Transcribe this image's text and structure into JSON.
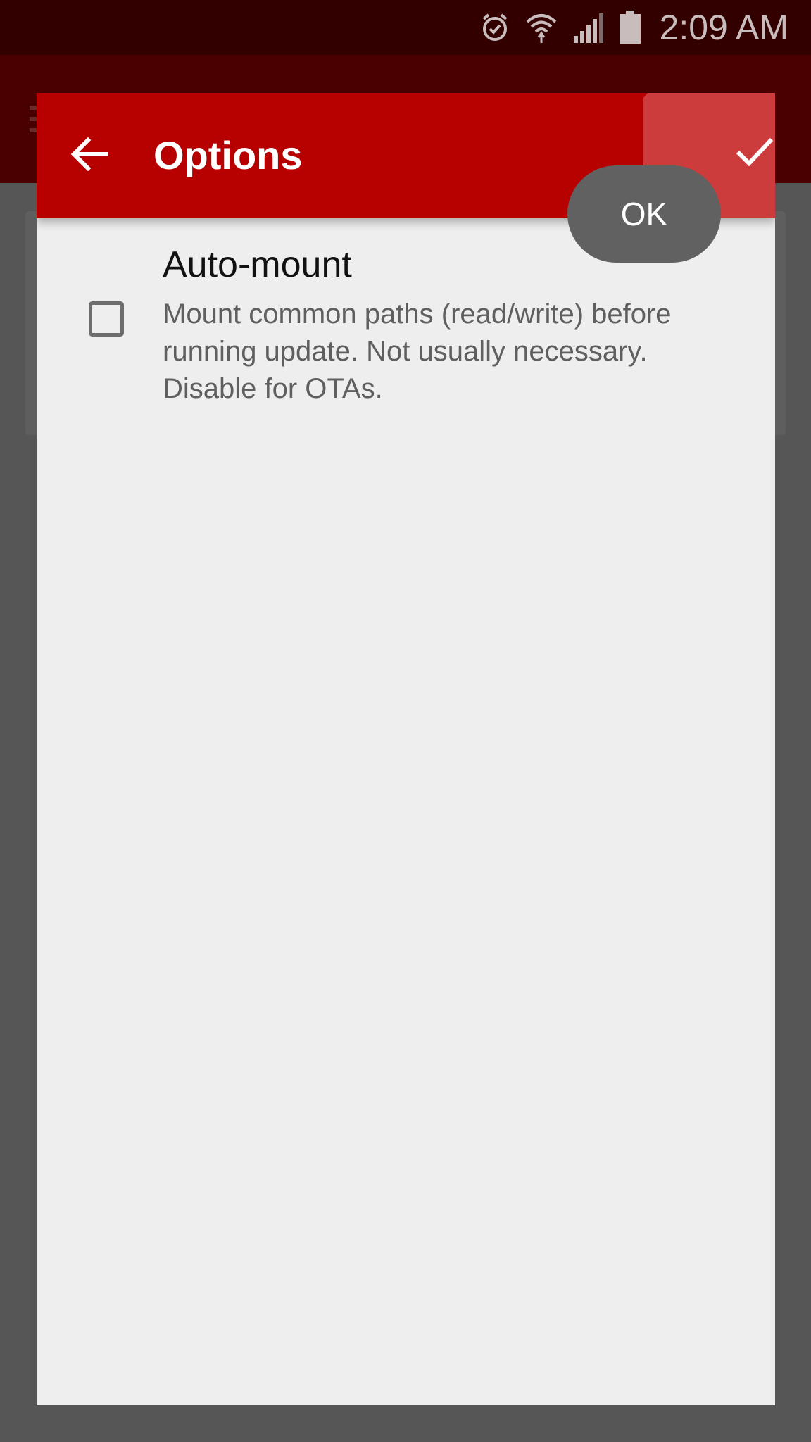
{
  "status_bar": {
    "time": "2:09 AM",
    "icons": [
      "alarm-icon",
      "wifi-icon",
      "signal-icon",
      "battery-icon"
    ]
  },
  "dialog": {
    "title": "Options",
    "back_icon": "arrow-back-icon",
    "confirm_icon": "check-icon",
    "tooltip": "OK"
  },
  "options": [
    {
      "title": "Auto-mount",
      "description": "Mount common paths (read/write) before running update. Not usually necessary. Disable for OTAs.",
      "checked": false
    }
  ],
  "colors": {
    "toolbar": "#b70000",
    "status_bar": "#330000",
    "dialog_bg": "#eeeeee",
    "scrim": "#565656"
  }
}
